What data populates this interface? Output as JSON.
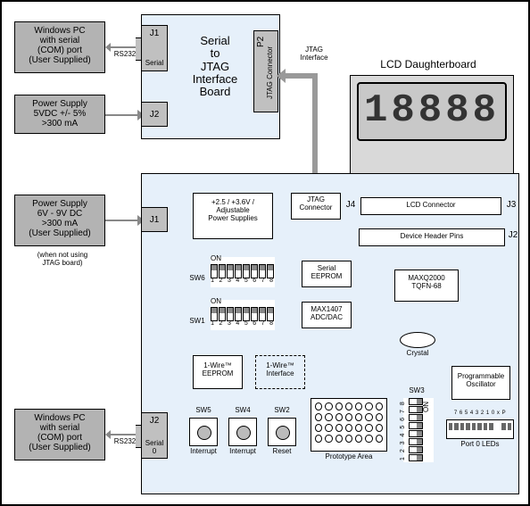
{
  "externals": {
    "pc_top": "Windows PC\nwith serial\n(COM) port\n(User Supplied)",
    "rs232_top": "RS232",
    "psu_top": "Power Supply\n5VDC +/- 5%\n>300 mA",
    "psu_mid": "Power Supply\n6V - 9V DC\n>300 mA\n(User Supplied)",
    "psu_mid_note": "(when not using\nJTAG board)",
    "pc_bot": "Windows PC\nwith serial\n(COM) port\n(User Supplied)",
    "rs232_bot": "RS232"
  },
  "serial_board": {
    "title": "Serial\nto\nJTAG\nInterface\nBoard",
    "j1_tag": "J1",
    "j1_lbl": "Serial",
    "j2_tag": "J2",
    "p2_tag": "P2",
    "p2_lbl": "JTAG\nConnector",
    "jtag_iface": "JTAG\nInterface"
  },
  "lcd": {
    "title": "LCD Daughterboard",
    "segments": "18888",
    "conn_lbl": "LCD Connector",
    "j3_tag": "J3"
  },
  "main": {
    "j1_tag": "J1",
    "j2_tag": "J2",
    "j2_lbl": "Serial\n0",
    "psu_lbl": "+2.5 / +3.6V /\nAdjustable\nPower Supplies",
    "jtag_conn": "JTAG\nConnector",
    "j4_tag": "J4",
    "hdr_pins": "Device Header Pins",
    "hdr_pins_tag": "J2",
    "sw6_tag": "SW6",
    "sw1_tag": "SW1",
    "dip_on": "ON",
    "dip_nums": "1 2 3 4 5 6 7 8",
    "serial_eeprom": "Serial\nEEPROM",
    "max1407": "MAX1407\nADC/DAC",
    "maxq": "MAXQ2000\nTQFN-68",
    "crystal": "Crystal",
    "onewire_eeprom": "1-Wire™\nEEPROM",
    "onewire_iface": "1-Wire™\nInterface",
    "prog_osc": "Programmable\nOscillator",
    "sw5_tag": "SW5",
    "sw5_lbl": "Interrupt",
    "sw4_tag": "SW4",
    "sw4_lbl": "Interrupt",
    "sw2_tag": "SW2",
    "sw2_lbl": "Reset",
    "proto_lbl": "Prototype Area",
    "sw3_tag": "SW3",
    "port_leds_lbl": "Port 0 LEDs",
    "port_leds_nums": "7 6 5 4 3 2 1 0   x P"
  }
}
